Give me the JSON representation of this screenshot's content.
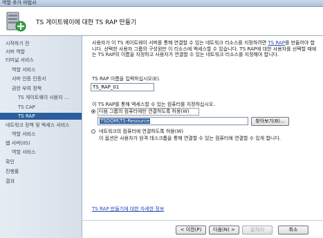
{
  "window": {
    "title": "역할 추가 마법사"
  },
  "header": {
    "title": "TS 게이트웨이에 대한 TS RAP 만들기"
  },
  "sidebar": {
    "items": [
      {
        "label": "시작하기 전"
      },
      {
        "label": "서버 역할"
      },
      {
        "label": "터미널 서비스"
      },
      {
        "label": "역할 서비스"
      },
      {
        "label": "서버 인증 인증서"
      },
      {
        "label": "권한 부여 정책"
      },
      {
        "label": "TS 게이트웨이 사용자 ..."
      },
      {
        "label": "TS CAP"
      },
      {
        "label": "TS RAP",
        "active": true
      },
      {
        "label": "네트워크 정책 및 액세스 서비스"
      },
      {
        "label": "역할 서비스"
      },
      {
        "label": "웹 서버(IIS)"
      },
      {
        "label": "역할 서비스"
      },
      {
        "label": "확인"
      },
      {
        "label": "진행률"
      },
      {
        "label": "결과"
      }
    ]
  },
  "main": {
    "intro_pre": "사용자가 이 TS 게이트웨이 서버를 통해 연결할 수 있는 네트워크 리소스를 지정하려면 ",
    "intro_link": "TS RAP",
    "intro_post": "를 만들어야 합니다. 선택한 사용자 그룹의 구성원만 이 리소스에 액세스할 수 있습니다. TS RAP에 대한 사용자를 선택할 때에는 TS RAP의 이름을 지정하고 사용자가 연결할 수 있는 네트워크 리소스를 지정해야 합니다.",
    "name_label": "TS RAP 이름을 입력하십시오(E).",
    "name_value": "TS_RAP_01",
    "computers_label": "이 TS RAP를 통해 액세스할 수 있는 컴퓨터를 지정하십시오.",
    "option_group_label": "다음 그룹의 컴퓨터에만 연결하도록 허용(W)",
    "group_value": "TSDOM\\TS-Resource",
    "browse_label": "찾아보기(B)...",
    "option_any_label": "네트워크의 컴퓨터에 연결하도록 허용(W)",
    "option_any_note": "이 옵션은 사용자가 원격 데스크톱을 통해 연결할 수 있는 컴퓨터에 연결할 수 있게 합니다.",
    "help_link": "TS RAP 만들기에 대한 자세한 정보"
  },
  "footer": {
    "back_label": "< 이전(P)",
    "next_label": "다음(N) >",
    "install_label": "설치(I)",
    "cancel_label": "취소"
  }
}
